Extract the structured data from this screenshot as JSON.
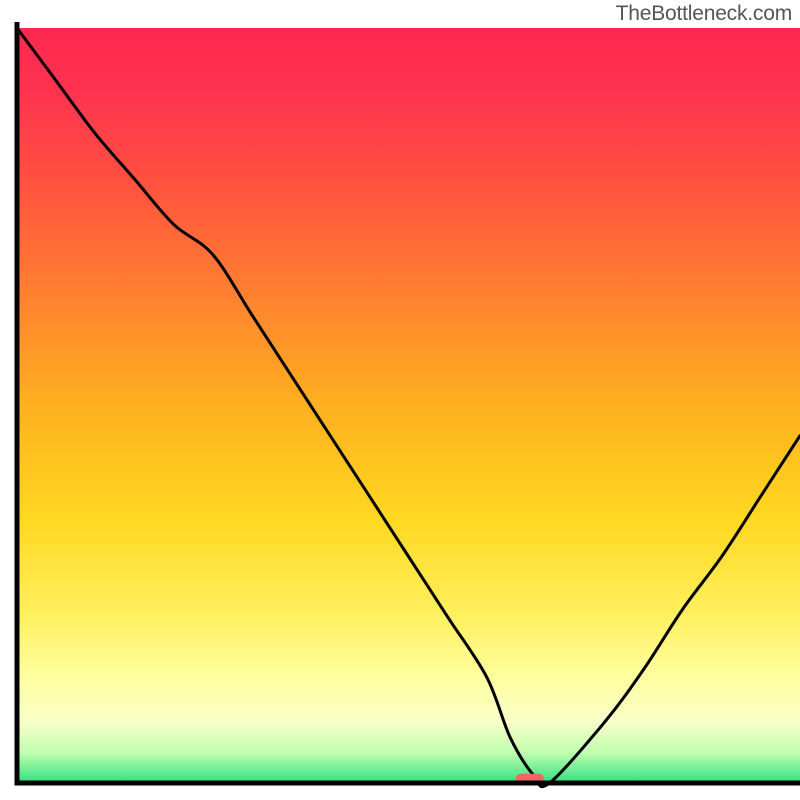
{
  "watermark": "TheBottleneck.com",
  "chart_data": {
    "type": "line",
    "title": "",
    "xlabel": "",
    "ylabel": "",
    "xlim": [
      0,
      100
    ],
    "ylim": [
      0,
      100
    ],
    "x": [
      0,
      5,
      10,
      15,
      20,
      25,
      30,
      35,
      40,
      45,
      50,
      55,
      60,
      63,
      66,
      68,
      75,
      80,
      85,
      90,
      95,
      100
    ],
    "values": [
      100,
      93,
      86,
      80,
      74,
      70,
      62,
      54,
      46,
      38,
      30,
      22,
      14,
      6,
      1,
      0,
      8,
      15,
      23,
      30,
      38,
      46
    ],
    "gradient_stops": [
      {
        "offset": 0.0,
        "color": "#ff2850"
      },
      {
        "offset": 0.08,
        "color": "#ff3250"
      },
      {
        "offset": 0.2,
        "color": "#ff5040"
      },
      {
        "offset": 0.35,
        "color": "#ff8030"
      },
      {
        "offset": 0.5,
        "color": "#ffb020"
      },
      {
        "offset": 0.65,
        "color": "#ffd820"
      },
      {
        "offset": 0.78,
        "color": "#fff060"
      },
      {
        "offset": 0.86,
        "color": "#ffffa0"
      },
      {
        "offset": 0.92,
        "color": "#f8ffc8"
      },
      {
        "offset": 0.96,
        "color": "#c0ffb0"
      },
      {
        "offset": 1.0,
        "color": "#30e080"
      }
    ],
    "marker": {
      "x": 65.5,
      "y": 0.5,
      "color": "#ef6666"
    },
    "axis_color": "#000000"
  }
}
